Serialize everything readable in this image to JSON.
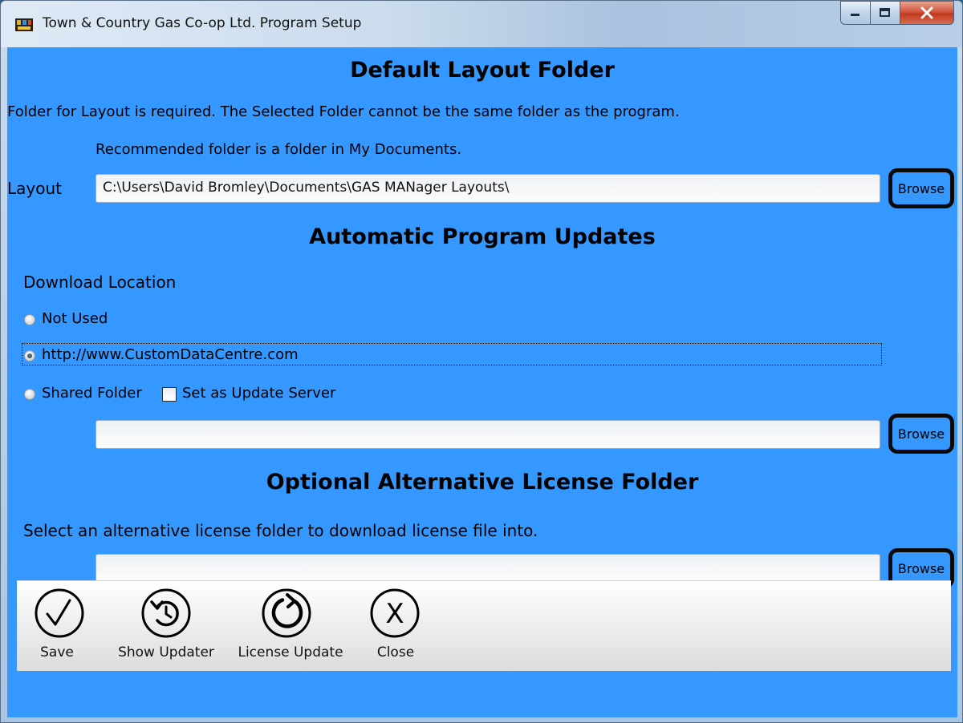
{
  "window": {
    "title": "Town & Country Gas Co-op Ltd. Program Setup",
    "min_symbol": "–",
    "max_symbol": "□",
    "close_symbol": "X"
  },
  "layout_section": {
    "heading": "Default Layout Folder",
    "description": "Folder for Layout is required. The Selected Folder cannot be the same folder as the program.",
    "recommendation": "Recommended folder is a folder in My Documents.",
    "field_label": "Layout",
    "path": "C:\\Users\\David Bromley\\Documents\\GAS MANager Layouts\\",
    "browse_label": "Browse"
  },
  "updates_section": {
    "heading": "Automatic Program Updates",
    "download_location_label": "Download Location",
    "options": [
      {
        "label": "Not Used",
        "selected": false
      },
      {
        "label": "http://www.CustomDataCentre.com",
        "selected": true
      },
      {
        "label": "Shared Folder",
        "selected": false
      }
    ],
    "update_server_checkbox": {
      "label": "Set as Update Server",
      "checked": false
    },
    "shared_folder_path": "",
    "browse_label": "Browse"
  },
  "license_section": {
    "heading": "Optional Alternative License Folder",
    "description": "Select an alternative license folder to download license file into.",
    "path": "",
    "browse_label": "Browse"
  },
  "toolbar": {
    "save_label": "Save",
    "show_updater_label": "Show Updater",
    "license_update_label": "License Update",
    "close_label": "Close",
    "close_icon_glyph": "X"
  },
  "colors": {
    "client_background": "#3498ff",
    "toolbar_background": "#ececec",
    "browse_border": "#0a0a0a"
  }
}
